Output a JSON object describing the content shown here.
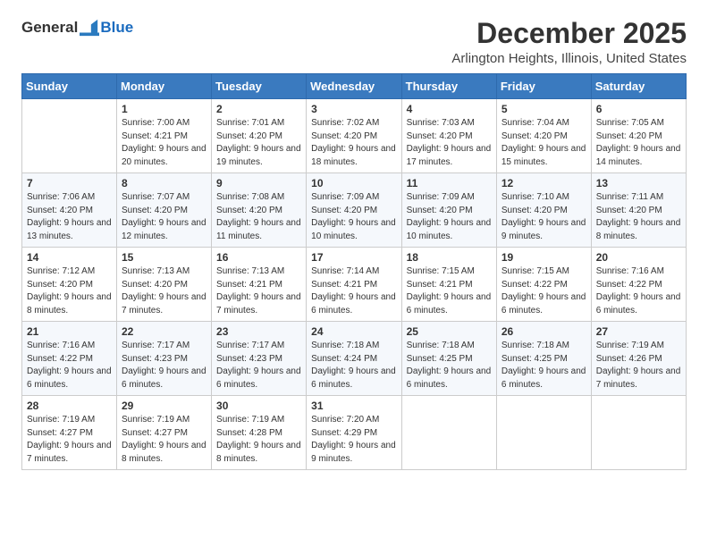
{
  "logo": {
    "general": "General",
    "blue": "Blue"
  },
  "title": "December 2025",
  "location": "Arlington Heights, Illinois, United States",
  "days_of_week": [
    "Sunday",
    "Monday",
    "Tuesday",
    "Wednesday",
    "Thursday",
    "Friday",
    "Saturday"
  ],
  "weeks": [
    [
      {
        "day": "",
        "sunrise": "",
        "sunset": "",
        "daylight": ""
      },
      {
        "day": "1",
        "sunrise": "Sunrise: 7:00 AM",
        "sunset": "Sunset: 4:21 PM",
        "daylight": "Daylight: 9 hours and 20 minutes."
      },
      {
        "day": "2",
        "sunrise": "Sunrise: 7:01 AM",
        "sunset": "Sunset: 4:20 PM",
        "daylight": "Daylight: 9 hours and 19 minutes."
      },
      {
        "day": "3",
        "sunrise": "Sunrise: 7:02 AM",
        "sunset": "Sunset: 4:20 PM",
        "daylight": "Daylight: 9 hours and 18 minutes."
      },
      {
        "day": "4",
        "sunrise": "Sunrise: 7:03 AM",
        "sunset": "Sunset: 4:20 PM",
        "daylight": "Daylight: 9 hours and 17 minutes."
      },
      {
        "day": "5",
        "sunrise": "Sunrise: 7:04 AM",
        "sunset": "Sunset: 4:20 PM",
        "daylight": "Daylight: 9 hours and 15 minutes."
      },
      {
        "day": "6",
        "sunrise": "Sunrise: 7:05 AM",
        "sunset": "Sunset: 4:20 PM",
        "daylight": "Daylight: 9 hours and 14 minutes."
      }
    ],
    [
      {
        "day": "7",
        "sunrise": "Sunrise: 7:06 AM",
        "sunset": "Sunset: 4:20 PM",
        "daylight": "Daylight: 9 hours and 13 minutes."
      },
      {
        "day": "8",
        "sunrise": "Sunrise: 7:07 AM",
        "sunset": "Sunset: 4:20 PM",
        "daylight": "Daylight: 9 hours and 12 minutes."
      },
      {
        "day": "9",
        "sunrise": "Sunrise: 7:08 AM",
        "sunset": "Sunset: 4:20 PM",
        "daylight": "Daylight: 9 hours and 11 minutes."
      },
      {
        "day": "10",
        "sunrise": "Sunrise: 7:09 AM",
        "sunset": "Sunset: 4:20 PM",
        "daylight": "Daylight: 9 hours and 10 minutes."
      },
      {
        "day": "11",
        "sunrise": "Sunrise: 7:09 AM",
        "sunset": "Sunset: 4:20 PM",
        "daylight": "Daylight: 9 hours and 10 minutes."
      },
      {
        "day": "12",
        "sunrise": "Sunrise: 7:10 AM",
        "sunset": "Sunset: 4:20 PM",
        "daylight": "Daylight: 9 hours and 9 minutes."
      },
      {
        "day": "13",
        "sunrise": "Sunrise: 7:11 AM",
        "sunset": "Sunset: 4:20 PM",
        "daylight": "Daylight: 9 hours and 8 minutes."
      }
    ],
    [
      {
        "day": "14",
        "sunrise": "Sunrise: 7:12 AM",
        "sunset": "Sunset: 4:20 PM",
        "daylight": "Daylight: 9 hours and 8 minutes."
      },
      {
        "day": "15",
        "sunrise": "Sunrise: 7:13 AM",
        "sunset": "Sunset: 4:20 PM",
        "daylight": "Daylight: 9 hours and 7 minutes."
      },
      {
        "day": "16",
        "sunrise": "Sunrise: 7:13 AM",
        "sunset": "Sunset: 4:21 PM",
        "daylight": "Daylight: 9 hours and 7 minutes."
      },
      {
        "day": "17",
        "sunrise": "Sunrise: 7:14 AM",
        "sunset": "Sunset: 4:21 PM",
        "daylight": "Daylight: 9 hours and 6 minutes."
      },
      {
        "day": "18",
        "sunrise": "Sunrise: 7:15 AM",
        "sunset": "Sunset: 4:21 PM",
        "daylight": "Daylight: 9 hours and 6 minutes."
      },
      {
        "day": "19",
        "sunrise": "Sunrise: 7:15 AM",
        "sunset": "Sunset: 4:22 PM",
        "daylight": "Daylight: 9 hours and 6 minutes."
      },
      {
        "day": "20",
        "sunrise": "Sunrise: 7:16 AM",
        "sunset": "Sunset: 4:22 PM",
        "daylight": "Daylight: 9 hours and 6 minutes."
      }
    ],
    [
      {
        "day": "21",
        "sunrise": "Sunrise: 7:16 AM",
        "sunset": "Sunset: 4:22 PM",
        "daylight": "Daylight: 9 hours and 6 minutes."
      },
      {
        "day": "22",
        "sunrise": "Sunrise: 7:17 AM",
        "sunset": "Sunset: 4:23 PM",
        "daylight": "Daylight: 9 hours and 6 minutes."
      },
      {
        "day": "23",
        "sunrise": "Sunrise: 7:17 AM",
        "sunset": "Sunset: 4:23 PM",
        "daylight": "Daylight: 9 hours and 6 minutes."
      },
      {
        "day": "24",
        "sunrise": "Sunrise: 7:18 AM",
        "sunset": "Sunset: 4:24 PM",
        "daylight": "Daylight: 9 hours and 6 minutes."
      },
      {
        "day": "25",
        "sunrise": "Sunrise: 7:18 AM",
        "sunset": "Sunset: 4:25 PM",
        "daylight": "Daylight: 9 hours and 6 minutes."
      },
      {
        "day": "26",
        "sunrise": "Sunrise: 7:18 AM",
        "sunset": "Sunset: 4:25 PM",
        "daylight": "Daylight: 9 hours and 6 minutes."
      },
      {
        "day": "27",
        "sunrise": "Sunrise: 7:19 AM",
        "sunset": "Sunset: 4:26 PM",
        "daylight": "Daylight: 9 hours and 7 minutes."
      }
    ],
    [
      {
        "day": "28",
        "sunrise": "Sunrise: 7:19 AM",
        "sunset": "Sunset: 4:27 PM",
        "daylight": "Daylight: 9 hours and 7 minutes."
      },
      {
        "day": "29",
        "sunrise": "Sunrise: 7:19 AM",
        "sunset": "Sunset: 4:27 PM",
        "daylight": "Daylight: 9 hours and 8 minutes."
      },
      {
        "day": "30",
        "sunrise": "Sunrise: 7:19 AM",
        "sunset": "Sunset: 4:28 PM",
        "daylight": "Daylight: 9 hours and 8 minutes."
      },
      {
        "day": "31",
        "sunrise": "Sunrise: 7:20 AM",
        "sunset": "Sunset: 4:29 PM",
        "daylight": "Daylight: 9 hours and 9 minutes."
      },
      {
        "day": "",
        "sunrise": "",
        "sunset": "",
        "daylight": ""
      },
      {
        "day": "",
        "sunrise": "",
        "sunset": "",
        "daylight": ""
      },
      {
        "day": "",
        "sunrise": "",
        "sunset": "",
        "daylight": ""
      }
    ]
  ]
}
